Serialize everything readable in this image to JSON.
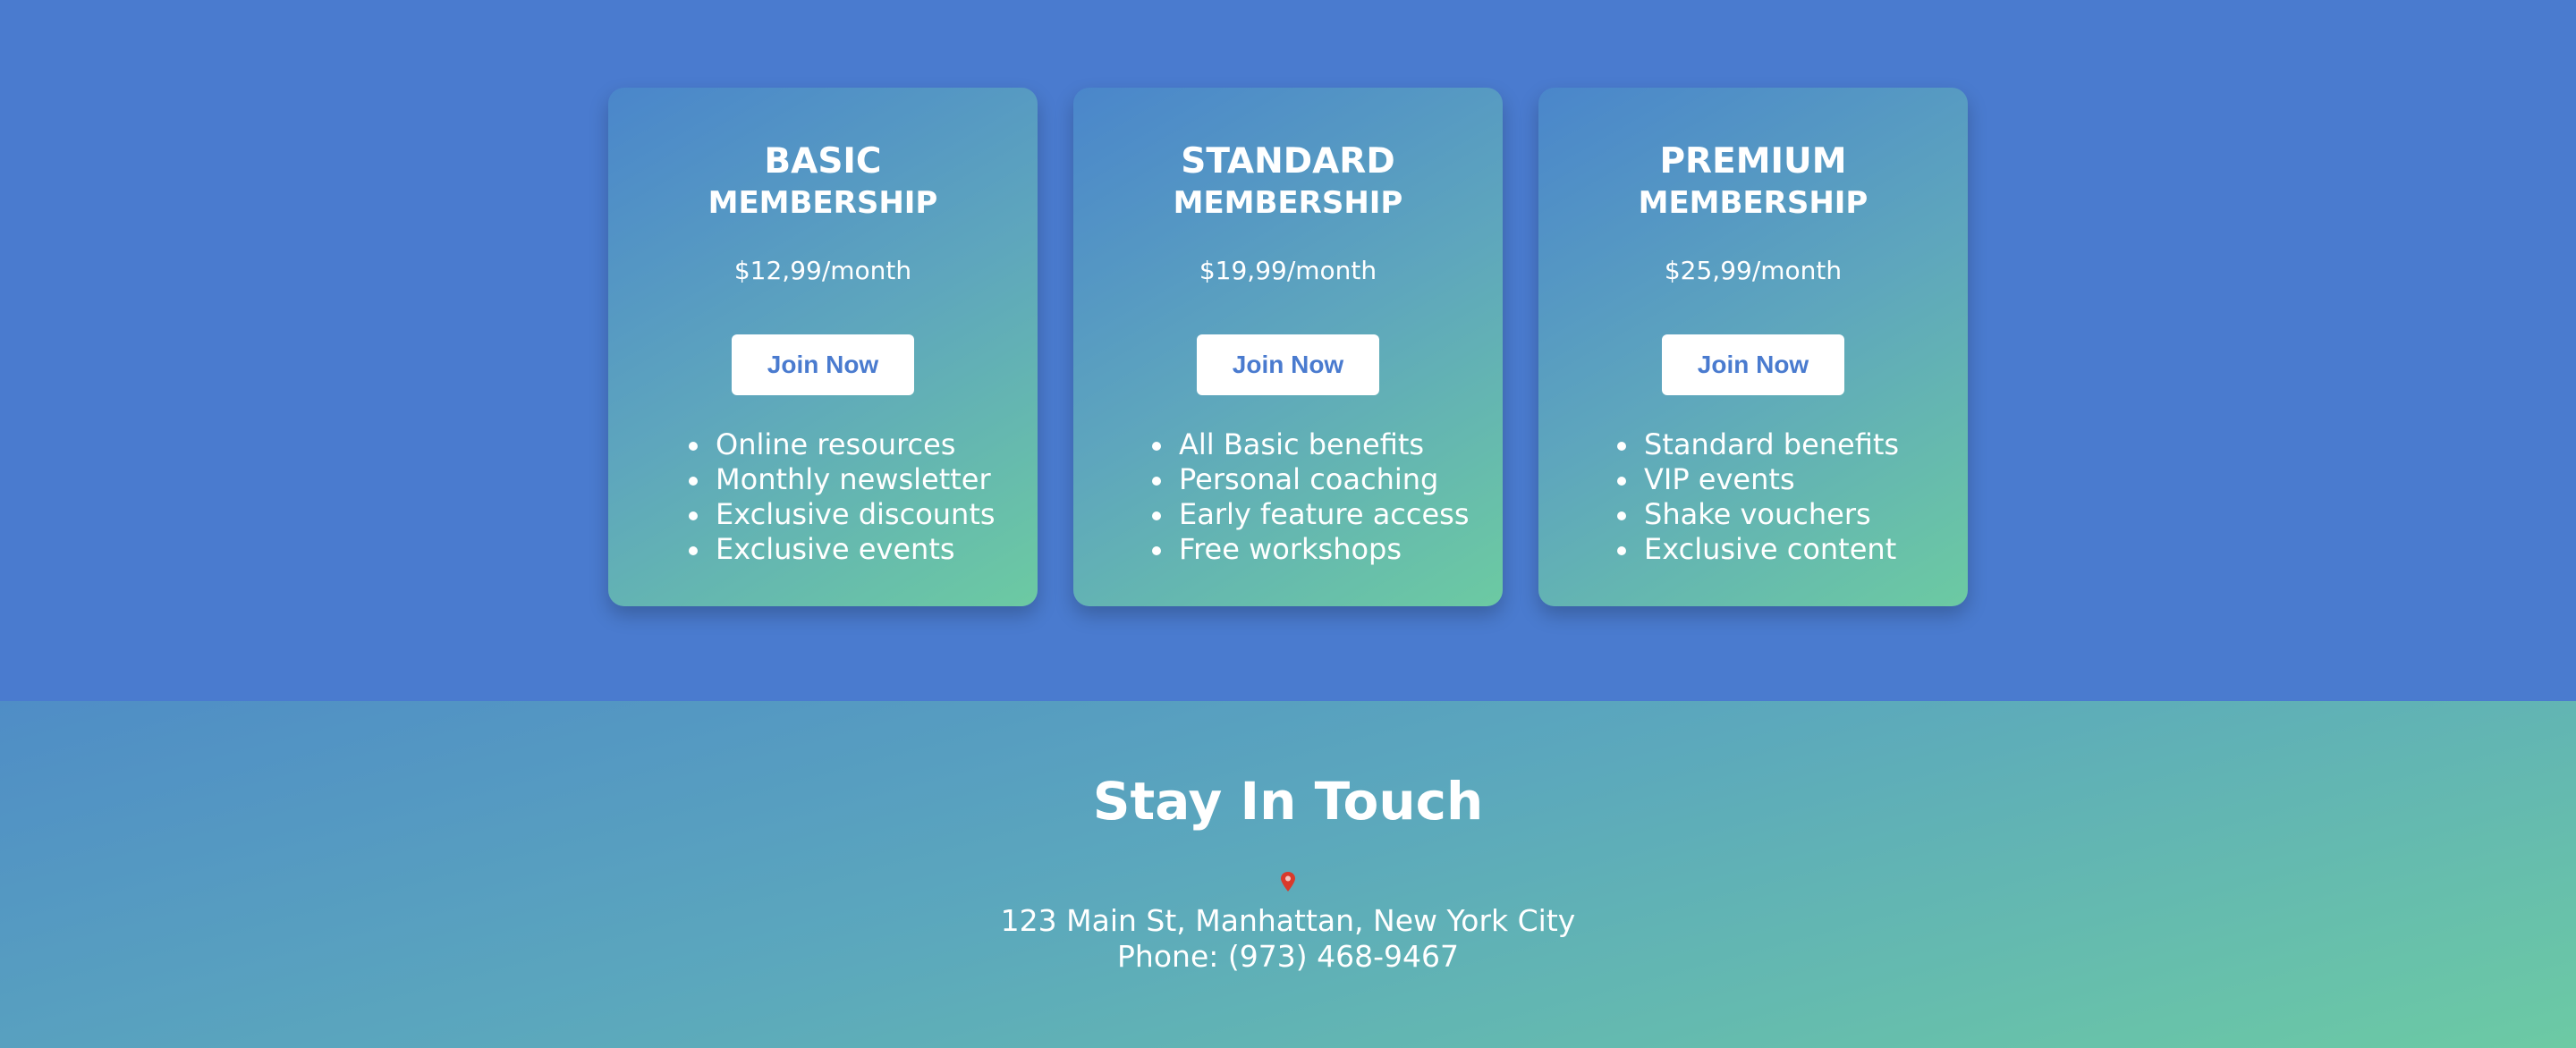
{
  "plans": [
    {
      "title_line1": "BASIC",
      "title_line2": "MEMBERSHIP",
      "price": "$12,99/month",
      "button_label": "Join Now",
      "features": [
        "Online resources",
        "Monthly newsletter",
        "Exclusive discounts",
        "Exclusive events"
      ]
    },
    {
      "title_line1": "STANDARD",
      "title_line2": "MEMBERSHIP",
      "price": "$19,99/month",
      "button_label": "Join Now",
      "features": [
        "All Basic benefits",
        "Personal coaching",
        "Early feature access",
        "Free workshops"
      ]
    },
    {
      "title_line1": "PREMIUM",
      "title_line2": "MEMBERSHIP",
      "price": "$25,99/month",
      "button_label": "Join Now",
      "features": [
        "Standard benefits",
        "VIP events",
        "Shake vouchers",
        "Exclusive content"
      ]
    }
  ],
  "contact": {
    "title": "Stay In Touch",
    "icon": "map-pin-icon",
    "address": "123 Main St, Manhattan, New York City",
    "phone": "Phone: (973) 468-9467"
  },
  "colors": {
    "page_background": "#4a7bcf",
    "button_text": "#4a7bcf",
    "card_gradient_start": "#4a86cb",
    "card_gradient_end": "#6ccaa2",
    "pin_red": "#d93a2b"
  }
}
